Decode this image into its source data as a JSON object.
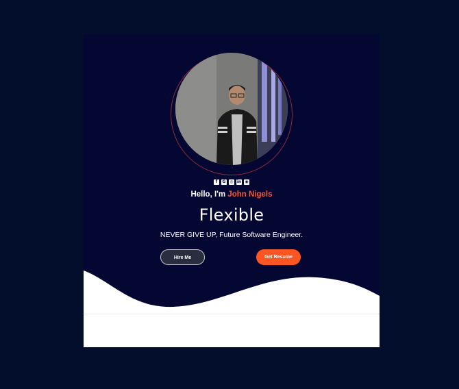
{
  "profile": {
    "greeting_prefix": "Hello, I'm ",
    "name": "John Nigels",
    "headline": "Flexible",
    "tagline": "NEVER GIVE UP, Future Software Engineer."
  },
  "socials": [
    {
      "icon": "facebook-icon",
      "glyph": "f"
    },
    {
      "icon": "google-icon",
      "glyph": "G"
    },
    {
      "icon": "instagram-icon",
      "glyph": "◎"
    },
    {
      "icon": "linkedin-icon",
      "glyph": "in"
    },
    {
      "icon": "camera-icon",
      "glyph": "◉"
    }
  ],
  "buttons": {
    "hire_label": "Hire Me",
    "resume_label": "Get Resume"
  },
  "colors": {
    "page_background": "#030e2c",
    "card_background": "#050733",
    "accent": "#ff5522",
    "wave": "#ffffff"
  }
}
